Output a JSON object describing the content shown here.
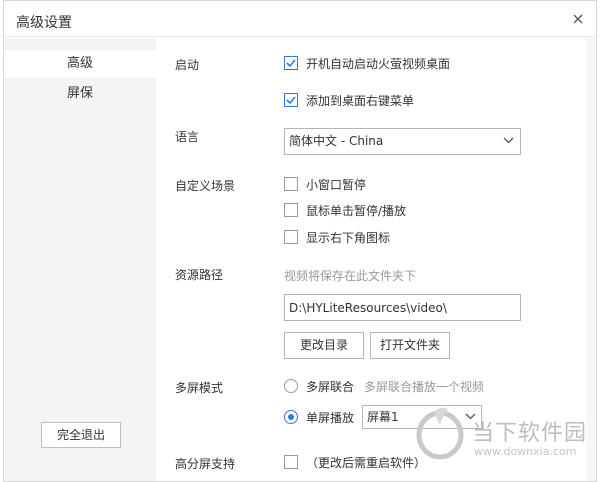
{
  "window": {
    "title": "高级设置"
  },
  "sidebar": {
    "items": [
      {
        "label": "高级",
        "active": true
      },
      {
        "label": "屏保",
        "active": false
      }
    ],
    "exit_label": "完全退出"
  },
  "startup": {
    "label": "启动",
    "options": [
      {
        "label": "开机自动启动火萤视频桌面",
        "checked": true
      },
      {
        "label": "添加到桌面右键菜单",
        "checked": true
      }
    ]
  },
  "language": {
    "label": "语言",
    "value": "简体中文 - China"
  },
  "custom_scene": {
    "label": "自定义场景",
    "options": [
      {
        "label": "小窗口暂停",
        "checked": false
      },
      {
        "label": "鼠标单击暂停/播放",
        "checked": false
      },
      {
        "label": "显示右下角图标",
        "checked": false
      }
    ]
  },
  "resource_path": {
    "label": "资源路径",
    "hint": "视频将保存在此文件夹下",
    "value": "D:\\HYLiteResources\\video\\",
    "change_label": "更改目录",
    "open_label": "打开文件夹"
  },
  "multi_screen": {
    "label": "多屏模式",
    "options": [
      {
        "label": "多屏联合",
        "checked": false,
        "hint": "多屏联合播放一个视频"
      },
      {
        "label": "单屏播放",
        "checked": true
      }
    ],
    "screen_value": "屏幕1"
  },
  "hidpi": {
    "label": "高分屏支持",
    "checked": false,
    "hint": "（更改后需重启软件）"
  },
  "watermark": {
    "text": "当下软件园",
    "url": "www.downxia.com"
  },
  "colors": {
    "accent": "#2f7ad8",
    "sidebar_bg": "#f4f4f4"
  }
}
